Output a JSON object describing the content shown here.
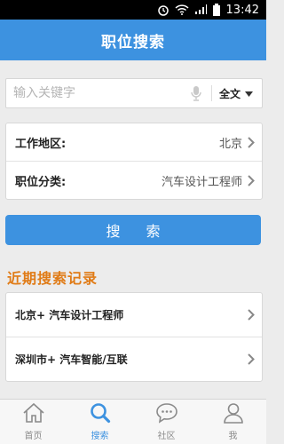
{
  "status": {
    "time": "13:42"
  },
  "header": {
    "title": "职位搜索"
  },
  "search": {
    "placeholder": "输入关键字",
    "scope": "全文"
  },
  "filters": {
    "location_label": "工作地区:",
    "location_value": "北京",
    "category_label": "职位分类:",
    "category_value": "汽车设计工程师"
  },
  "search_button": "搜 索",
  "recent": {
    "title": "近期搜索记录",
    "items": [
      {
        "label": "北京+ 汽车设计工程师"
      },
      {
        "label": "深圳市+ 汽车智能/互联"
      }
    ]
  },
  "tabs": [
    {
      "label": "首页",
      "icon": "home-icon"
    },
    {
      "label": "搜索",
      "icon": "search-icon"
    },
    {
      "label": "社区",
      "icon": "chat-icon"
    },
    {
      "label": "我",
      "icon": "user-icon"
    }
  ],
  "colors": {
    "primary": "#3d92e0",
    "accent": "#e07b16"
  }
}
